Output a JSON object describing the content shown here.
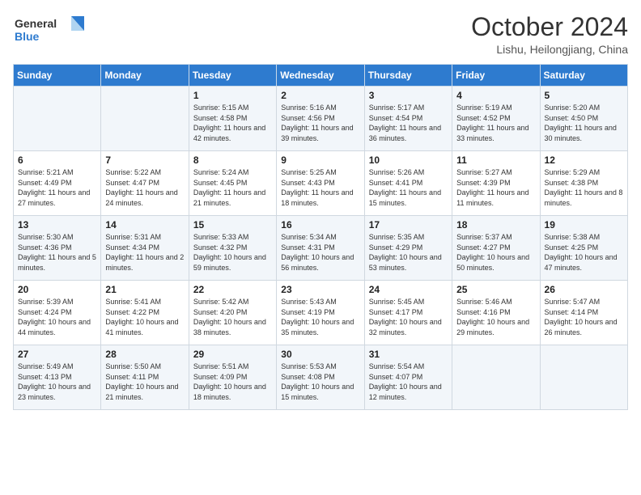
{
  "logo": {
    "line1": "General",
    "line2": "Blue"
  },
  "title": "October 2024",
  "location": "Lishu, Heilongjiang, China",
  "weekdays": [
    "Sunday",
    "Monday",
    "Tuesday",
    "Wednesday",
    "Thursday",
    "Friday",
    "Saturday"
  ],
  "weeks": [
    [
      {
        "day": "",
        "sunrise": "",
        "sunset": "",
        "daylight": ""
      },
      {
        "day": "",
        "sunrise": "",
        "sunset": "",
        "daylight": ""
      },
      {
        "day": "1",
        "sunrise": "Sunrise: 5:15 AM",
        "sunset": "Sunset: 4:58 PM",
        "daylight": "Daylight: 11 hours and 42 minutes."
      },
      {
        "day": "2",
        "sunrise": "Sunrise: 5:16 AM",
        "sunset": "Sunset: 4:56 PM",
        "daylight": "Daylight: 11 hours and 39 minutes."
      },
      {
        "day": "3",
        "sunrise": "Sunrise: 5:17 AM",
        "sunset": "Sunset: 4:54 PM",
        "daylight": "Daylight: 11 hours and 36 minutes."
      },
      {
        "day": "4",
        "sunrise": "Sunrise: 5:19 AM",
        "sunset": "Sunset: 4:52 PM",
        "daylight": "Daylight: 11 hours and 33 minutes."
      },
      {
        "day": "5",
        "sunrise": "Sunrise: 5:20 AM",
        "sunset": "Sunset: 4:50 PM",
        "daylight": "Daylight: 11 hours and 30 minutes."
      }
    ],
    [
      {
        "day": "6",
        "sunrise": "Sunrise: 5:21 AM",
        "sunset": "Sunset: 4:49 PM",
        "daylight": "Daylight: 11 hours and 27 minutes."
      },
      {
        "day": "7",
        "sunrise": "Sunrise: 5:22 AM",
        "sunset": "Sunset: 4:47 PM",
        "daylight": "Daylight: 11 hours and 24 minutes."
      },
      {
        "day": "8",
        "sunrise": "Sunrise: 5:24 AM",
        "sunset": "Sunset: 4:45 PM",
        "daylight": "Daylight: 11 hours and 21 minutes."
      },
      {
        "day": "9",
        "sunrise": "Sunrise: 5:25 AM",
        "sunset": "Sunset: 4:43 PM",
        "daylight": "Daylight: 11 hours and 18 minutes."
      },
      {
        "day": "10",
        "sunrise": "Sunrise: 5:26 AM",
        "sunset": "Sunset: 4:41 PM",
        "daylight": "Daylight: 11 hours and 15 minutes."
      },
      {
        "day": "11",
        "sunrise": "Sunrise: 5:27 AM",
        "sunset": "Sunset: 4:39 PM",
        "daylight": "Daylight: 11 hours and 11 minutes."
      },
      {
        "day": "12",
        "sunrise": "Sunrise: 5:29 AM",
        "sunset": "Sunset: 4:38 PM",
        "daylight": "Daylight: 11 hours and 8 minutes."
      }
    ],
    [
      {
        "day": "13",
        "sunrise": "Sunrise: 5:30 AM",
        "sunset": "Sunset: 4:36 PM",
        "daylight": "Daylight: 11 hours and 5 minutes."
      },
      {
        "day": "14",
        "sunrise": "Sunrise: 5:31 AM",
        "sunset": "Sunset: 4:34 PM",
        "daylight": "Daylight: 11 hours and 2 minutes."
      },
      {
        "day": "15",
        "sunrise": "Sunrise: 5:33 AM",
        "sunset": "Sunset: 4:32 PM",
        "daylight": "Daylight: 10 hours and 59 minutes."
      },
      {
        "day": "16",
        "sunrise": "Sunrise: 5:34 AM",
        "sunset": "Sunset: 4:31 PM",
        "daylight": "Daylight: 10 hours and 56 minutes."
      },
      {
        "day": "17",
        "sunrise": "Sunrise: 5:35 AM",
        "sunset": "Sunset: 4:29 PM",
        "daylight": "Daylight: 10 hours and 53 minutes."
      },
      {
        "day": "18",
        "sunrise": "Sunrise: 5:37 AM",
        "sunset": "Sunset: 4:27 PM",
        "daylight": "Daylight: 10 hours and 50 minutes."
      },
      {
        "day": "19",
        "sunrise": "Sunrise: 5:38 AM",
        "sunset": "Sunset: 4:25 PM",
        "daylight": "Daylight: 10 hours and 47 minutes."
      }
    ],
    [
      {
        "day": "20",
        "sunrise": "Sunrise: 5:39 AM",
        "sunset": "Sunset: 4:24 PM",
        "daylight": "Daylight: 10 hours and 44 minutes."
      },
      {
        "day": "21",
        "sunrise": "Sunrise: 5:41 AM",
        "sunset": "Sunset: 4:22 PM",
        "daylight": "Daylight: 10 hours and 41 minutes."
      },
      {
        "day": "22",
        "sunrise": "Sunrise: 5:42 AM",
        "sunset": "Sunset: 4:20 PM",
        "daylight": "Daylight: 10 hours and 38 minutes."
      },
      {
        "day": "23",
        "sunrise": "Sunrise: 5:43 AM",
        "sunset": "Sunset: 4:19 PM",
        "daylight": "Daylight: 10 hours and 35 minutes."
      },
      {
        "day": "24",
        "sunrise": "Sunrise: 5:45 AM",
        "sunset": "Sunset: 4:17 PM",
        "daylight": "Daylight: 10 hours and 32 minutes."
      },
      {
        "day": "25",
        "sunrise": "Sunrise: 5:46 AM",
        "sunset": "Sunset: 4:16 PM",
        "daylight": "Daylight: 10 hours and 29 minutes."
      },
      {
        "day": "26",
        "sunrise": "Sunrise: 5:47 AM",
        "sunset": "Sunset: 4:14 PM",
        "daylight": "Daylight: 10 hours and 26 minutes."
      }
    ],
    [
      {
        "day": "27",
        "sunrise": "Sunrise: 5:49 AM",
        "sunset": "Sunset: 4:13 PM",
        "daylight": "Daylight: 10 hours and 23 minutes."
      },
      {
        "day": "28",
        "sunrise": "Sunrise: 5:50 AM",
        "sunset": "Sunset: 4:11 PM",
        "daylight": "Daylight: 10 hours and 21 minutes."
      },
      {
        "day": "29",
        "sunrise": "Sunrise: 5:51 AM",
        "sunset": "Sunset: 4:09 PM",
        "daylight": "Daylight: 10 hours and 18 minutes."
      },
      {
        "day": "30",
        "sunrise": "Sunrise: 5:53 AM",
        "sunset": "Sunset: 4:08 PM",
        "daylight": "Daylight: 10 hours and 15 minutes."
      },
      {
        "day": "31",
        "sunrise": "Sunrise: 5:54 AM",
        "sunset": "Sunset: 4:07 PM",
        "daylight": "Daylight: 10 hours and 12 minutes."
      },
      {
        "day": "",
        "sunrise": "",
        "sunset": "",
        "daylight": ""
      },
      {
        "day": "",
        "sunrise": "",
        "sunset": "",
        "daylight": ""
      }
    ]
  ]
}
